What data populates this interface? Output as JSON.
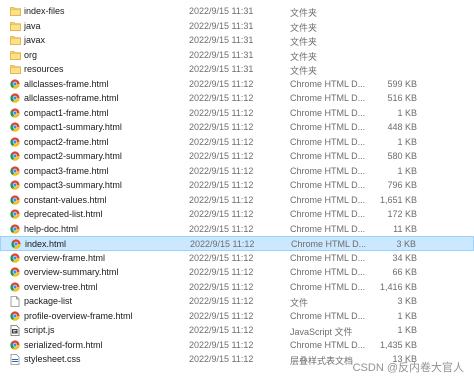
{
  "files": [
    {
      "name": "index-files",
      "date": "2022/9/15 11:31",
      "type": "文件夹",
      "size": "",
      "icon": "folder-icon"
    },
    {
      "name": "java",
      "date": "2022/9/15 11:31",
      "type": "文件夹",
      "size": "",
      "icon": "folder-icon"
    },
    {
      "name": "javax",
      "date": "2022/9/15 11:31",
      "type": "文件夹",
      "size": "",
      "icon": "folder-icon"
    },
    {
      "name": "org",
      "date": "2022/9/15 11:31",
      "type": "文件夹",
      "size": "",
      "icon": "folder-icon"
    },
    {
      "name": "resources",
      "date": "2022/9/15 11:31",
      "type": "文件夹",
      "size": "",
      "icon": "folder-icon"
    },
    {
      "name": "allclasses-frame.html",
      "date": "2022/9/15 11:12",
      "type": "Chrome HTML D...",
      "size": "599 KB",
      "icon": "chrome-icon"
    },
    {
      "name": "allclasses-noframe.html",
      "date": "2022/9/15 11:12",
      "type": "Chrome HTML D...",
      "size": "516 KB",
      "icon": "chrome-icon"
    },
    {
      "name": "compact1-frame.html",
      "date": "2022/9/15 11:12",
      "type": "Chrome HTML D...",
      "size": "1 KB",
      "icon": "chrome-icon"
    },
    {
      "name": "compact1-summary.html",
      "date": "2022/9/15 11:12",
      "type": "Chrome HTML D...",
      "size": "448 KB",
      "icon": "chrome-icon"
    },
    {
      "name": "compact2-frame.html",
      "date": "2022/9/15 11:12",
      "type": "Chrome HTML D...",
      "size": "1 KB",
      "icon": "chrome-icon"
    },
    {
      "name": "compact2-summary.html",
      "date": "2022/9/15 11:12",
      "type": "Chrome HTML D...",
      "size": "580 KB",
      "icon": "chrome-icon"
    },
    {
      "name": "compact3-frame.html",
      "date": "2022/9/15 11:12",
      "type": "Chrome HTML D...",
      "size": "1 KB",
      "icon": "chrome-icon"
    },
    {
      "name": "compact3-summary.html",
      "date": "2022/9/15 11:12",
      "type": "Chrome HTML D...",
      "size": "796 KB",
      "icon": "chrome-icon"
    },
    {
      "name": "constant-values.html",
      "date": "2022/9/15 11:12",
      "type": "Chrome HTML D...",
      "size": "1,651 KB",
      "icon": "chrome-icon"
    },
    {
      "name": "deprecated-list.html",
      "date": "2022/9/15 11:12",
      "type": "Chrome HTML D...",
      "size": "172 KB",
      "icon": "chrome-icon"
    },
    {
      "name": "help-doc.html",
      "date": "2022/9/15 11:12",
      "type": "Chrome HTML D...",
      "size": "11 KB",
      "icon": "chrome-icon"
    },
    {
      "name": "index.html",
      "date": "2022/9/15 11:12",
      "type": "Chrome HTML D...",
      "size": "3 KB",
      "icon": "chrome-icon",
      "selected": true
    },
    {
      "name": "overview-frame.html",
      "date": "2022/9/15 11:12",
      "type": "Chrome HTML D...",
      "size": "34 KB",
      "icon": "chrome-icon"
    },
    {
      "name": "overview-summary.html",
      "date": "2022/9/15 11:12",
      "type": "Chrome HTML D...",
      "size": "66 KB",
      "icon": "chrome-icon"
    },
    {
      "name": "overview-tree.html",
      "date": "2022/9/15 11:12",
      "type": "Chrome HTML D...",
      "size": "1,416 KB",
      "icon": "chrome-icon"
    },
    {
      "name": "package-list",
      "date": "2022/9/15 11:12",
      "type": "文件",
      "size": "3 KB",
      "icon": "blank-file-icon"
    },
    {
      "name": "profile-overview-frame.html",
      "date": "2022/9/15 11:12",
      "type": "Chrome HTML D...",
      "size": "1 KB",
      "icon": "chrome-icon"
    },
    {
      "name": "script.js",
      "date": "2022/9/15 11:12",
      "type": "JavaScript 文件",
      "size": "1 KB",
      "icon": "script-file-icon"
    },
    {
      "name": "serialized-form.html",
      "date": "2022/9/15 11:12",
      "type": "Chrome HTML D...",
      "size": "1,435 KB",
      "icon": "chrome-icon"
    },
    {
      "name": "stylesheet.css",
      "date": "2022/9/15 11:12",
      "type": "层叠样式表文档",
      "size": "13 KB",
      "icon": "css-file-icon"
    }
  ],
  "watermark": "CSDN @反内卷大官人"
}
